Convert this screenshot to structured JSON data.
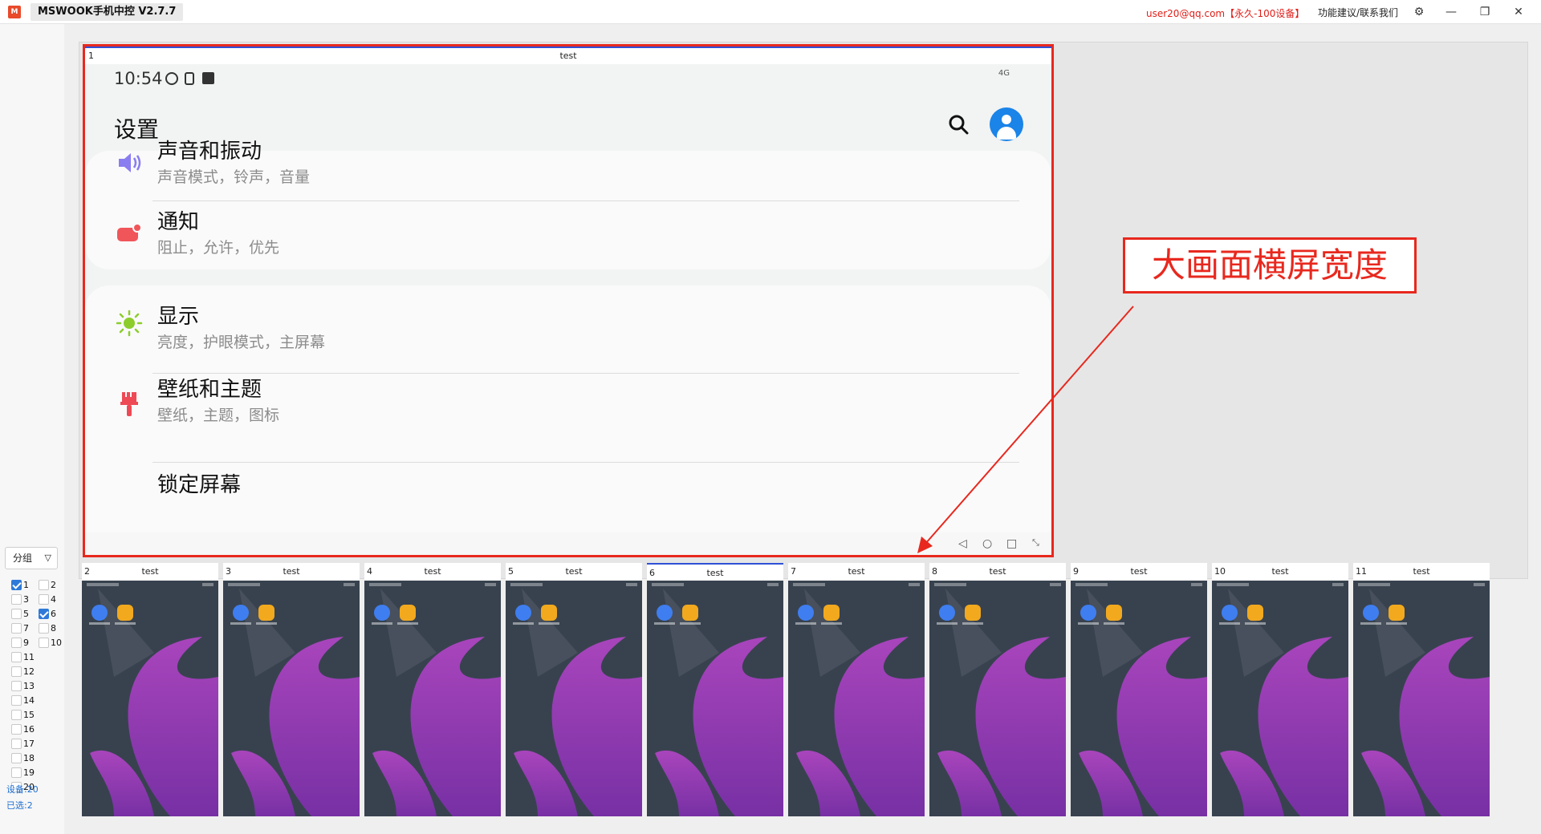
{
  "app": {
    "logo_text": "M",
    "title": "MSWOOK手机中控 V2.7.7",
    "account": "user20@qq.com【永久-100设备】",
    "feedback": "功能建议/联系我们",
    "icons": {
      "settings": "⚙",
      "minimize": "—",
      "restore": "❐",
      "close": "✕"
    }
  },
  "sidebar": {
    "group_label": "分组",
    "devices": [
      {
        "num": "1",
        "checked": true
      },
      {
        "num": "2",
        "checked": false
      },
      {
        "num": "3",
        "checked": false
      },
      {
        "num": "4",
        "checked": false
      },
      {
        "num": "5",
        "checked": false
      },
      {
        "num": "6",
        "checked": true
      },
      {
        "num": "7",
        "checked": false
      },
      {
        "num": "8",
        "checked": false
      },
      {
        "num": "9",
        "checked": false
      },
      {
        "num": "10",
        "checked": false
      },
      {
        "num": "11",
        "checked": false
      },
      {
        "num": "12",
        "checked": false
      },
      {
        "num": "13",
        "checked": false
      },
      {
        "num": "14",
        "checked": false
      },
      {
        "num": "15",
        "checked": false
      },
      {
        "num": "16",
        "checked": false
      },
      {
        "num": "17",
        "checked": false
      },
      {
        "num": "18",
        "checked": false
      },
      {
        "num": "19",
        "checked": false
      },
      {
        "num": "20",
        "checked": false
      }
    ],
    "device_count": "设备:20",
    "selected_count": "已选:2"
  },
  "big_screen": {
    "index": "1",
    "name": "test",
    "status_time": "10:54",
    "status_signal": "4G",
    "page_title": "设置",
    "groups": [
      [
        {
          "title": "声音和振动",
          "subtitle": "声音模式，铃声，音量",
          "icon": "speaker-icon",
          "color": "#8a7df0"
        },
        {
          "title": "通知",
          "subtitle": "阻止，允许，优先",
          "icon": "notification-icon",
          "color": "#f0555a"
        }
      ],
      [
        {
          "title": "显示",
          "subtitle": "亮度，护眼模式，主屏幕",
          "icon": "brightness-icon",
          "color": "#8ccd2c"
        },
        {
          "title": "壁纸和主题",
          "subtitle": "壁纸，主题，图标",
          "icon": "paintbrush-icon",
          "color": "#ee4a55"
        },
        {
          "title": "锁定屏幕",
          "subtitle": "",
          "icon": "lock-icon",
          "color": "#7c6ff0"
        }
      ]
    ]
  },
  "annotation": {
    "text": "大画面横屏宽度",
    "color": "#e8281e"
  },
  "thumbnails": [
    {
      "index": "2",
      "name": "test",
      "selected": false
    },
    {
      "index": "3",
      "name": "test",
      "selected": false
    },
    {
      "index": "4",
      "name": "test",
      "selected": false
    },
    {
      "index": "5",
      "name": "test",
      "selected": false
    },
    {
      "index": "6",
      "name": "test",
      "selected": true
    },
    {
      "index": "7",
      "name": "test",
      "selected": false
    },
    {
      "index": "8",
      "name": "test",
      "selected": false
    },
    {
      "index": "9",
      "name": "test",
      "selected": false
    },
    {
      "index": "10",
      "name": "test",
      "selected": false
    },
    {
      "index": "11",
      "name": "test",
      "selected": false
    }
  ],
  "colors": {
    "accent": "#2f50d8",
    "highlight": "#e8281e",
    "wallpaper": "#38424f",
    "wave": "#b545c8"
  }
}
